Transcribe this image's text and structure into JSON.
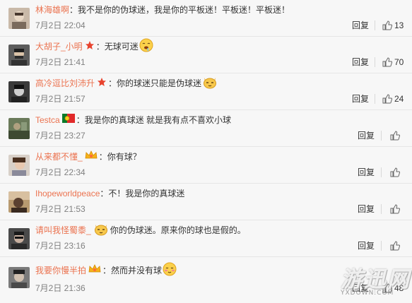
{
  "ui": {
    "reply_label": "回复"
  },
  "comments": [
    {
      "username": "林海雄啊",
      "content": "：我不是你的伪球迷，我是你的平板迷！平板迷！平板迷！",
      "time": "7月2日 22:04",
      "likes": "13",
      "badge": "",
      "emoji": ""
    },
    {
      "username": "大胡子_小明",
      "content": "：无球可迷",
      "time": "7月2日 21:41",
      "likes": "70",
      "badge": "star-badge-icon",
      "emoji": "drool-face-icon"
    },
    {
      "username": "高冷逗比刘沛升",
      "content": "：你的球迷只能是伪球迷",
      "time": "7月2日 21:57",
      "likes": "24",
      "badge": "star-badge-icon",
      "emoji": "cat-face-icon"
    },
    {
      "username": "Testca",
      "content": "：我是你的真球迷  就是我有点不喜欢小球",
      "time": "7月2日 23:27",
      "likes": "",
      "badge": "portugal-flag-icon",
      "emoji": ""
    },
    {
      "username": "从来都不懂_",
      "content": "：你有球？",
      "time": "7月2日 22:34",
      "likes": "",
      "badge": "vip-crown-icon",
      "emoji": ""
    },
    {
      "username": "Ihopeworldpeace",
      "content": "：不！我是你的真球迷",
      "time": "7月2日 21:53",
      "likes": "",
      "badge": "",
      "emoji": ""
    },
    {
      "username": "请叫我怪蜀黍_",
      "content": "你的伪球迷。原来你的球也是假的。",
      "time": "7月2日 23:16",
      "likes": "",
      "badge": "cat-face-icon",
      "emoji": ""
    },
    {
      "username": "我要你慢半拍",
      "content": "：然而并没有球",
      "time": "7月2日 21:36",
      "likes": "48",
      "badge": "vip-crown-icon",
      "emoji": "smirk-face-icon"
    }
  ],
  "watermark": {
    "text": "游迅网",
    "sub": "YXDOWN.COM"
  },
  "colors": {
    "username": "#eb7350",
    "text": "#333333",
    "time": "#808080",
    "background": "#f7f7f7"
  }
}
